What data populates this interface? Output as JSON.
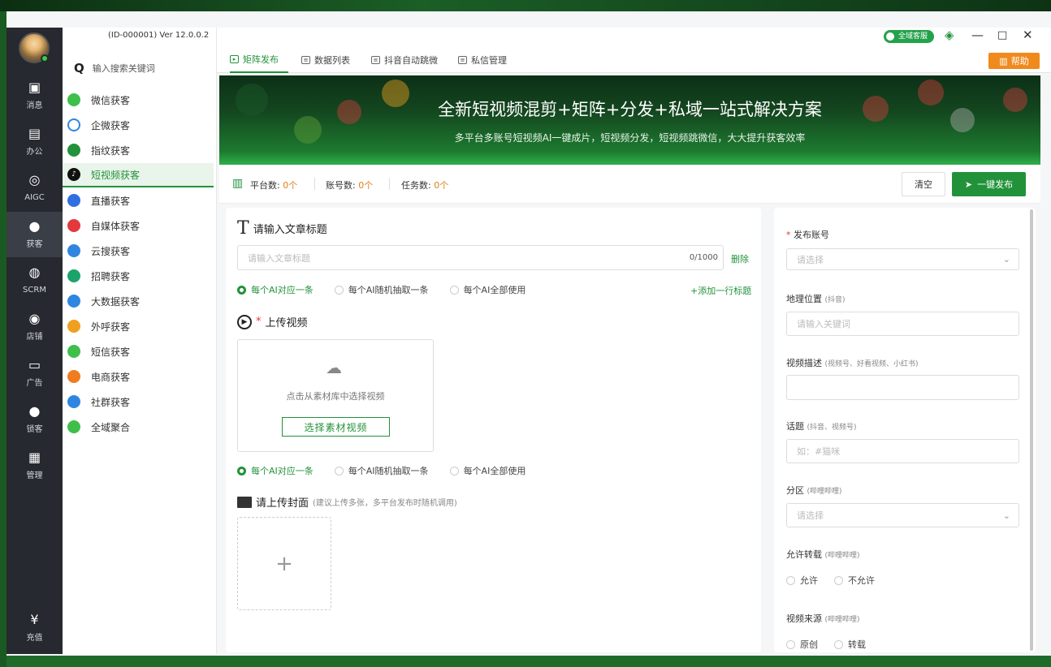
{
  "app": {
    "version": "(ID-000001)  Ver 12.0.0.2",
    "customer_service": "全域客服"
  },
  "rail": [
    {
      "icon": "message-icon",
      "label": "消息"
    },
    {
      "icon": "office-icon",
      "label": "办公"
    },
    {
      "icon": "aigc-icon",
      "label": "AIGC"
    },
    {
      "icon": "user-add-icon",
      "label": "获客"
    },
    {
      "icon": "scrm-icon",
      "label": "SCRM"
    },
    {
      "icon": "store-icon",
      "label": "店铺"
    },
    {
      "icon": "ads-icon",
      "label": "广告"
    },
    {
      "icon": "lock-user-icon",
      "label": "锁客"
    },
    {
      "icon": "grid-icon",
      "label": "管理"
    },
    {
      "icon": "yuan-icon",
      "label": "充值"
    }
  ],
  "sidebar": {
    "search_placeholder": "输入搜索关键词",
    "items": [
      {
        "label": "微信获客",
        "color": "#3fbf4a"
      },
      {
        "label": "企微获客",
        "color": "#2f86e0"
      },
      {
        "label": "指纹获客",
        "color": "#22923a"
      },
      {
        "label": "短视频获客",
        "color": "#111111"
      },
      {
        "label": "直播获客",
        "color": "#2f6fe0"
      },
      {
        "label": "自媒体获客",
        "color": "#e4393c"
      },
      {
        "label": "云搜获客",
        "color": "#2f86e0"
      },
      {
        "label": "招聘获客",
        "color": "#1aa36b"
      },
      {
        "label": "大数据获客",
        "color": "#2f86e0"
      },
      {
        "label": "外呼获客",
        "color": "#f0a020"
      },
      {
        "label": "短信获客",
        "color": "#3fbf4a"
      },
      {
        "label": "电商获客",
        "color": "#f07c20"
      },
      {
        "label": "社群获客",
        "color": "#2f86e0"
      },
      {
        "label": "全域聚合",
        "color": "#3fbf4a"
      }
    ]
  },
  "tabs": [
    {
      "label": "矩阵发布"
    },
    {
      "label": "数据列表"
    },
    {
      "label": "抖音自动跳微"
    },
    {
      "label": "私信管理"
    }
  ],
  "help_label": "帮助",
  "banner": {
    "title": "全新短视频混剪+矩阵+分发+私域一站式解决方案",
    "subtitle": "多平台多账号短视频AI一键成片，短视频分发，短视频跳微信，大大提升获客效率"
  },
  "stats": {
    "platforms_label": "平台数:",
    "platforms_value": "0个",
    "accounts_label": "账号数:",
    "accounts_value": "0个",
    "tasks_label": "任务数:",
    "tasks_value": "0个",
    "clear_label": "清空",
    "publish_label": "一键发布"
  },
  "form_left": {
    "title_section": "请输入文章标题",
    "title_placeholder": "请输入文章标题",
    "title_counter": "0/1000",
    "delete_label": "删除",
    "add_title_label": "+添加一行标题",
    "radio_options": [
      "每个AI对应一条",
      "每个AI随机抽取一条",
      "每个AI全部使用"
    ],
    "upload_video_label": "上传视频",
    "upload_hint": "点击从素材库中选择视频",
    "select_video_label": "选择素材视频",
    "cover_label": "请上传封面",
    "cover_hint": "(建议上传多张，多平台发布时随机调用)"
  },
  "form_right": {
    "account_label": "发布账号",
    "account_placeholder": "请选择",
    "location_label": "地理位置",
    "location_hint": "(抖音)",
    "location_placeholder": "请输入关键词",
    "desc_label": "视频描述",
    "desc_hint": "(视频号、好看视频、小红书)",
    "topic_label": "话题",
    "topic_hint": "(抖音、视频号)",
    "topic_placeholder": "如：#猫咪",
    "zone_label": "分区",
    "zone_hint": "(哔哩哔哩)",
    "zone_placeholder": "请选择",
    "repost_label": "允许转载",
    "repost_hint": "(哔哩哔哩)",
    "repost_options": [
      "允许",
      "不允许"
    ],
    "source_label": "视频来源",
    "source_hint": "(哔哩哔哩)",
    "source_options": [
      "原创",
      "转载"
    ]
  }
}
